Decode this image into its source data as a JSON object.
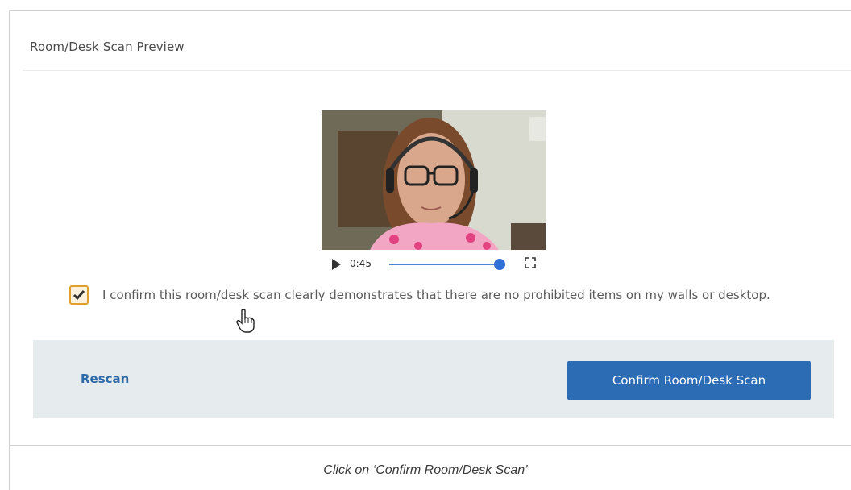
{
  "dialog": {
    "title": "Room/Desk Scan Preview"
  },
  "video": {
    "time": "0:45",
    "progress": 0.95
  },
  "confirmation": {
    "checked": true,
    "text": "I confirm this room/desk scan clearly demonstrates that there are no prohibited items on my walls or desktop."
  },
  "actions": {
    "rescan_label": "Rescan",
    "confirm_label": "Confirm Room/Desk Scan"
  },
  "caption": "Click on ‘Confirm Room/Desk Scan’",
  "colors": {
    "accent": "#2b6cb5",
    "link": "#2f6aa8",
    "panel_bg": "#e6ebed",
    "checkbox_border": "#e0a02a"
  }
}
